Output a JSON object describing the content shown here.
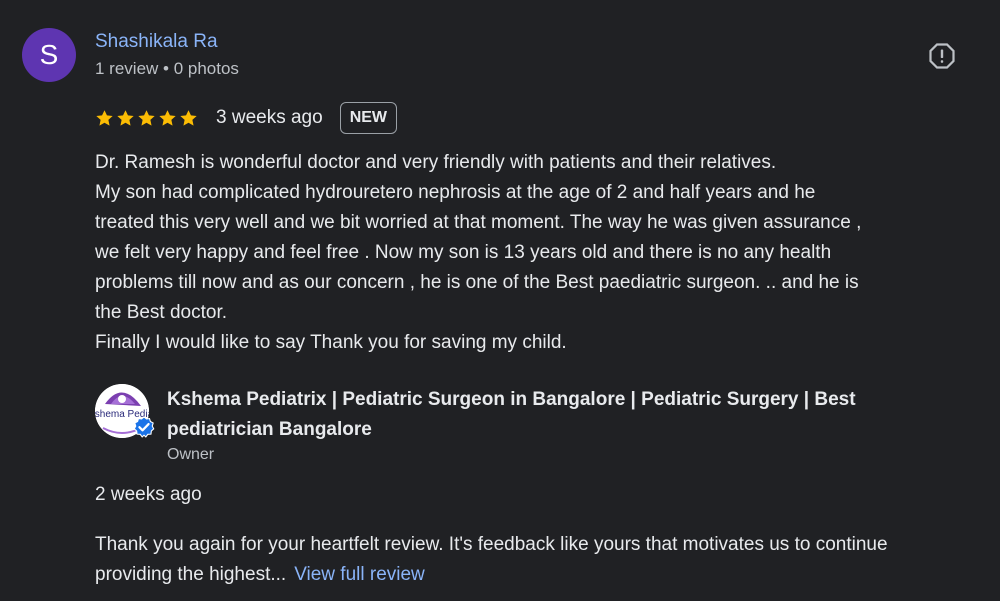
{
  "reviewer": {
    "initial": "S",
    "name": "Shashikala Ra",
    "meta": "1 review • 0 photos",
    "avatar_color": "#5e35b1"
  },
  "review": {
    "rating": 5,
    "time": "3 weeks ago",
    "badge": "NEW",
    "lines": [
      "Dr. Ramesh is wonderful doctor and very friendly with patients and their relatives.",
      "My son had complicated hydrouretero nephrosis at the age of 2 and half years and he",
      "treated this very well and we bit worried at that moment. The way he was given assurance ,",
      "we felt very happy and feel free . Now my son is 13 years old and there is no any health",
      "problems till now and as our concern , he is one of the Best paediatric surgeon. .. and he is",
      "the Best doctor.",
      "Finally I would like to say Thank you for saving my child."
    ]
  },
  "owner": {
    "logo_text": "Kshema Pediat",
    "name": "Kshema Pediatrix | Pediatric Surgeon in Bangalore | Pediatric Surgery | Best pediatrician Bangalore",
    "label": "Owner"
  },
  "reply": {
    "time": "2 weeks ago",
    "text": "Thank you again for your heartfelt review. It's feedback like yours that motivates us to continue providing the highest...",
    "link": "View full review"
  },
  "icons": {
    "report": "report-flag-icon",
    "star": "star-icon",
    "verified": "verified-check-icon"
  },
  "colors": {
    "background": "#202124",
    "link": "#8ab4f8",
    "star": "#fbbc04",
    "text": "#e8eaed",
    "secondary_text": "#bdc1c6"
  }
}
